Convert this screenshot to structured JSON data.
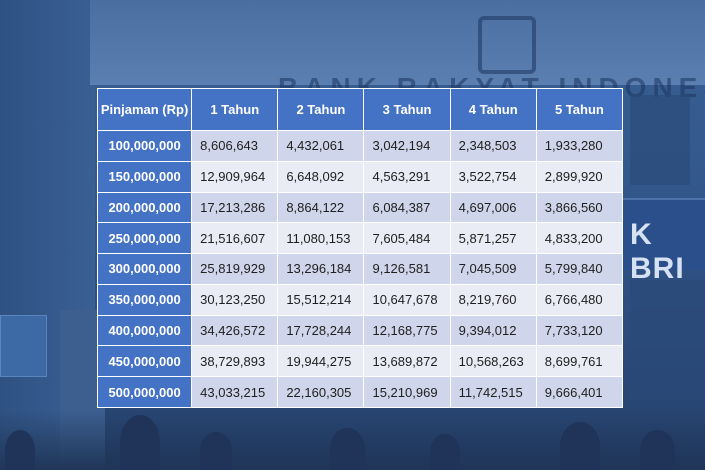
{
  "table": {
    "headers": [
      "Pinjaman (Rp)",
      "1 Tahun",
      "2 Tahun",
      "3 Tahun",
      "4 Tahun",
      "5 Tahun"
    ],
    "rows": [
      {
        "amount": "100,000,000",
        "values": [
          "8,606,643",
          "4,432,061",
          "3,042,194",
          "2,348,503",
          "1,933,280"
        ]
      },
      {
        "amount": "150,000,000",
        "values": [
          "12,909,964",
          "6,648,092",
          "4,563,291",
          "3,522,754",
          "2,899,920"
        ]
      },
      {
        "amount": "200,000,000",
        "values": [
          "17,213,286",
          "8,864,122",
          "6,084,387",
          "4,697,006",
          "3,866,560"
        ]
      },
      {
        "amount": "250,000,000",
        "values": [
          "21,516,607",
          "11,080,153",
          "7,605,484",
          "5,871,257",
          "4,833,200"
        ]
      },
      {
        "amount": "300,000,000",
        "values": [
          "25,819,929",
          "13,296,184",
          "9,126,581",
          "7,045,509",
          "5,799,840"
        ]
      },
      {
        "amount": "350,000,000",
        "values": [
          "30,123,250",
          "15,512,214",
          "10,647,678",
          "8,219,760",
          "6,766,480"
        ]
      },
      {
        "amount": "400,000,000",
        "values": [
          "34,426,572",
          "17,728,244",
          "12,168,775",
          "9,394,012",
          "7,733,120"
        ]
      },
      {
        "amount": "450,000,000",
        "values": [
          "38,729,893",
          "19,944,275",
          "13,689,872",
          "10,568,263",
          "8,699,761"
        ]
      },
      {
        "amount": "500,000,000",
        "values": [
          "43,033,215",
          "22,160,305",
          "15,210,969",
          "11,742,515",
          "9,666,401"
        ]
      }
    ]
  },
  "background": {
    "building_sign": "BANK RAKYAT INDONESIA",
    "bri_sign": "K BRI"
  },
  "colors": {
    "header": "#4472c4",
    "row_dark": "#cfd5ea",
    "row_light": "#e9ebf5"
  }
}
